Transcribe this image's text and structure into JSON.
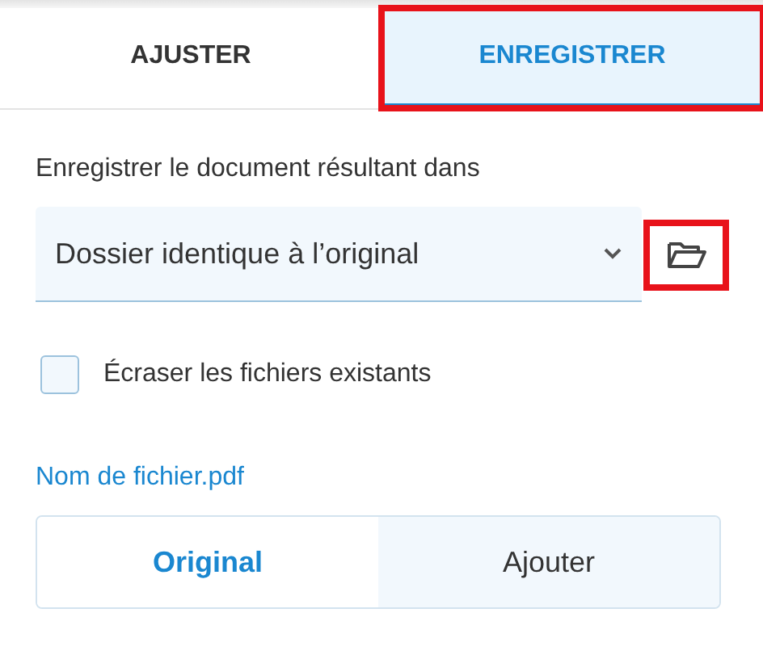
{
  "tabs": [
    {
      "label": "AJUSTER",
      "selected": false,
      "highlighted": false
    },
    {
      "label": "ENREGISTRER",
      "selected": true,
      "highlighted": true
    }
  ],
  "destination": {
    "label": "Enregistrer le document résultant dans",
    "value": "Dossier identique à l’original",
    "browse_highlighted": true
  },
  "overwrite": {
    "label": "Écraser les fichiers existants",
    "checked": false
  },
  "filename_link": "Nom de fichier.pdf",
  "mode": [
    {
      "label": "Original",
      "selected": true
    },
    {
      "label": "Ajouter",
      "selected": false
    }
  ]
}
